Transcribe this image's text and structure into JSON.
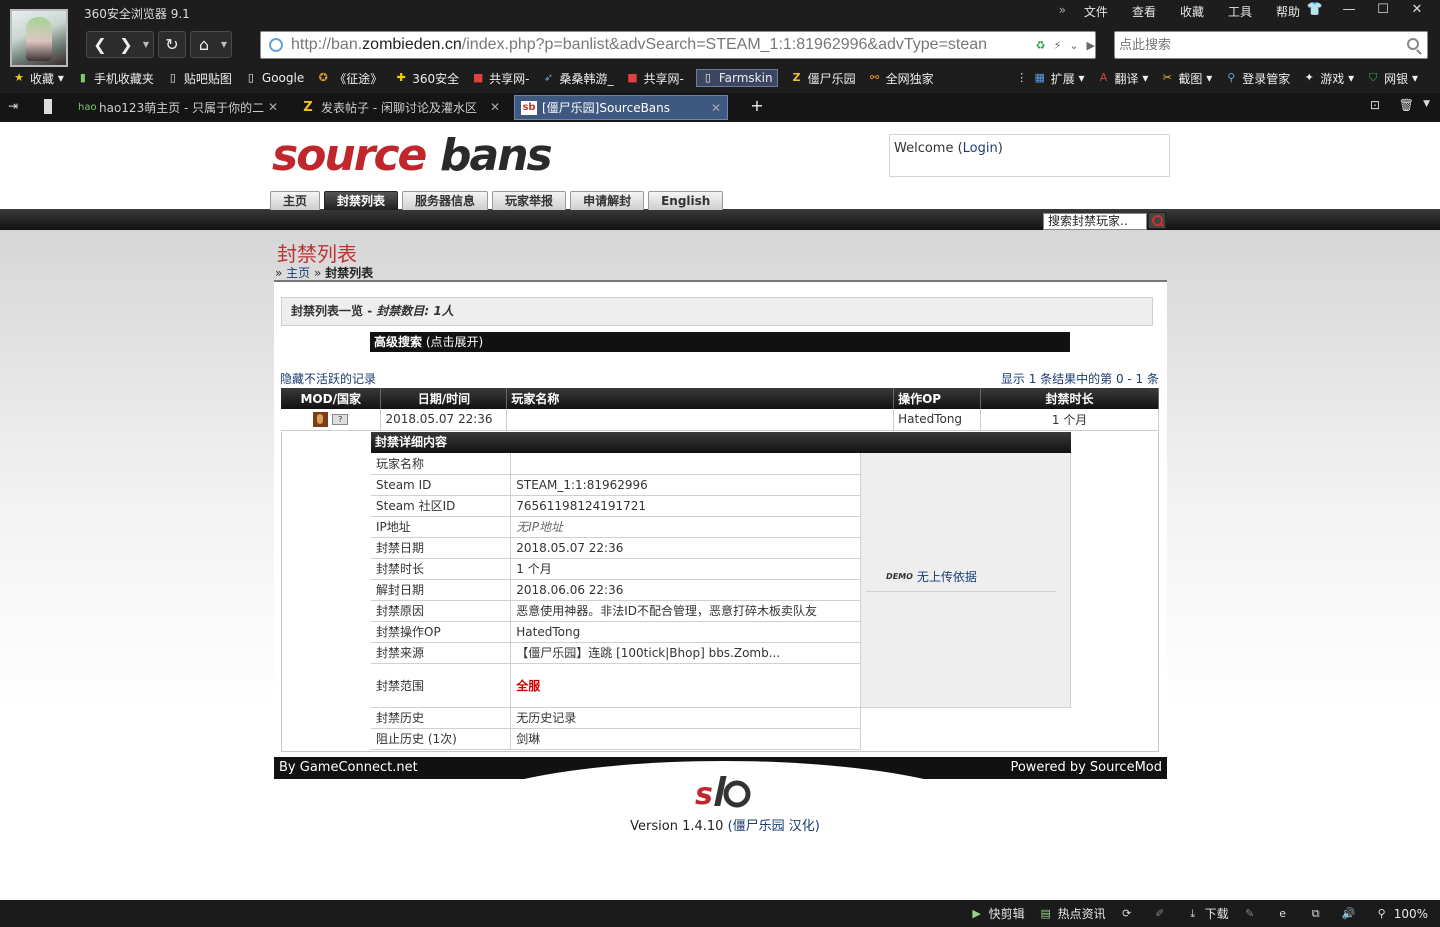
{
  "browser": {
    "title": "360安全浏览器 9.1",
    "menu": [
      "文件",
      "查看",
      "收藏",
      "工具",
      "帮助"
    ],
    "address": {
      "prefix": "http://ban.",
      "host": "zombieden.cn",
      "path": "/index.php?p=banlist&advSearch=STEAM_1:1:81962996&advType=stean"
    },
    "search_placeholder": "点此搜索",
    "bookmarks": [
      {
        "label": "收藏",
        "icon": "star-icon"
      },
      {
        "label": "手机收藏夹",
        "icon": "phone-icon"
      },
      {
        "label": "贴吧贴图",
        "icon": "page-icon"
      },
      {
        "label": "Google",
        "icon": "page-icon"
      },
      {
        "label": "《征途》",
        "icon": "game-icon"
      },
      {
        "label": "360安全",
        "icon": "plus-icon"
      },
      {
        "label": "共享网-",
        "icon": "share-icon"
      },
      {
        "label": "桑桑韩游_",
        "icon": "bird-icon"
      },
      {
        "label": "共享网-",
        "icon": "share-icon"
      },
      {
        "label": "Farmskin",
        "icon": "page-icon"
      },
      {
        "label": "僵尸乐园",
        "icon": "z-icon"
      },
      {
        "label": "全网独家",
        "icon": "link-icon"
      }
    ],
    "toolbar_right": [
      {
        "label": "扩展",
        "icon": "grid-icon"
      },
      {
        "label": "翻译",
        "icon": "translate-icon"
      },
      {
        "label": "截图",
        "icon": "scissors-icon"
      },
      {
        "label": "登录管家",
        "icon": "key-icon"
      },
      {
        "label": "游戏",
        "icon": "gamepad-icon"
      },
      {
        "label": "网银",
        "icon": "shield-icon"
      }
    ],
    "tabs": [
      {
        "label": "hao123萌主页 - 只属于你的二",
        "icon": "hao-icon"
      },
      {
        "label": "发表帖子 - 闲聊讨论及灌水区",
        "icon": "z-icon"
      },
      {
        "label": "[僵尸乐园]SourceBans",
        "icon": "sb-icon"
      }
    ],
    "status": {
      "items": [
        "快剪辑",
        "热点资讯",
        "下载"
      ],
      "zoom": "100%"
    }
  },
  "site": {
    "welcome_prefix": "Welcome (",
    "welcome_login": "Login",
    "welcome_suffix": ")",
    "nav": [
      "主页",
      "封禁列表",
      "服务器信息",
      "玩家举报",
      "申请解封",
      "English"
    ],
    "nav_active": 1,
    "search_box": "搜索封禁玩家..",
    "page_title": "封禁列表",
    "breadcrumb": {
      "home": "主页",
      "current": "封禁列表"
    },
    "list_header": {
      "title": "封禁列表一览",
      "sep": " - ",
      "count": "封禁数目: 1人"
    },
    "adv_search": {
      "bold": "高级搜索",
      "hint": " (点击展开)"
    },
    "hide_inactive": "隐藏不活跃的记录",
    "showing": "显示 1 条结果中的第 0 - 1 条",
    "columns": [
      "MOD/国家",
      "日期/时间",
      "玩家名称",
      "操作OP",
      "封禁时长"
    ],
    "row": {
      "flag": "?",
      "date": "2018.05.07 22:36",
      "player": "",
      "admin": "HatedTong",
      "length": "1 个月"
    },
    "details": {
      "header": "封禁详细内容",
      "fields": [
        {
          "k": "玩家名称",
          "v": ""
        },
        {
          "k": "Steam ID",
          "v": "STEAM_1:1:81962996"
        },
        {
          "k": "Steam 社区ID",
          "v": "76561198124191721"
        },
        {
          "k": "IP地址",
          "v": "无IP地址"
        },
        {
          "k": "封禁日期",
          "v": "2018.05.07 22:36"
        },
        {
          "k": "封禁时长",
          "v": "1 个月"
        },
        {
          "k": "解封日期",
          "v": "2018.06.06 22:36"
        },
        {
          "k": "封禁原因",
          "v": "恶意使用神器。非法ID不配合管理，恶意打碎木板卖队友"
        },
        {
          "k": "封禁操作OP",
          "v": "HatedTong"
        },
        {
          "k": "封禁来源",
          "v": "【僵尸乐园】连跳 [100tick|Bhop] bbs.Zomb..."
        },
        {
          "k": "封禁范围",
          "v": "全服"
        },
        {
          "k": "封禁历史",
          "v": "无历史记录"
        },
        {
          "k": "阻止历史 (1次)",
          "v": "剑琳"
        }
      ],
      "demo_badge": "DEMO",
      "demo": "无上传依据"
    },
    "footer": {
      "left": "By GameConnect.net",
      "right": "Powered by SourceMod"
    },
    "version": {
      "prefix": "Version 1.4.10 ",
      "link": "(僵尸乐园 汉化)"
    }
  }
}
